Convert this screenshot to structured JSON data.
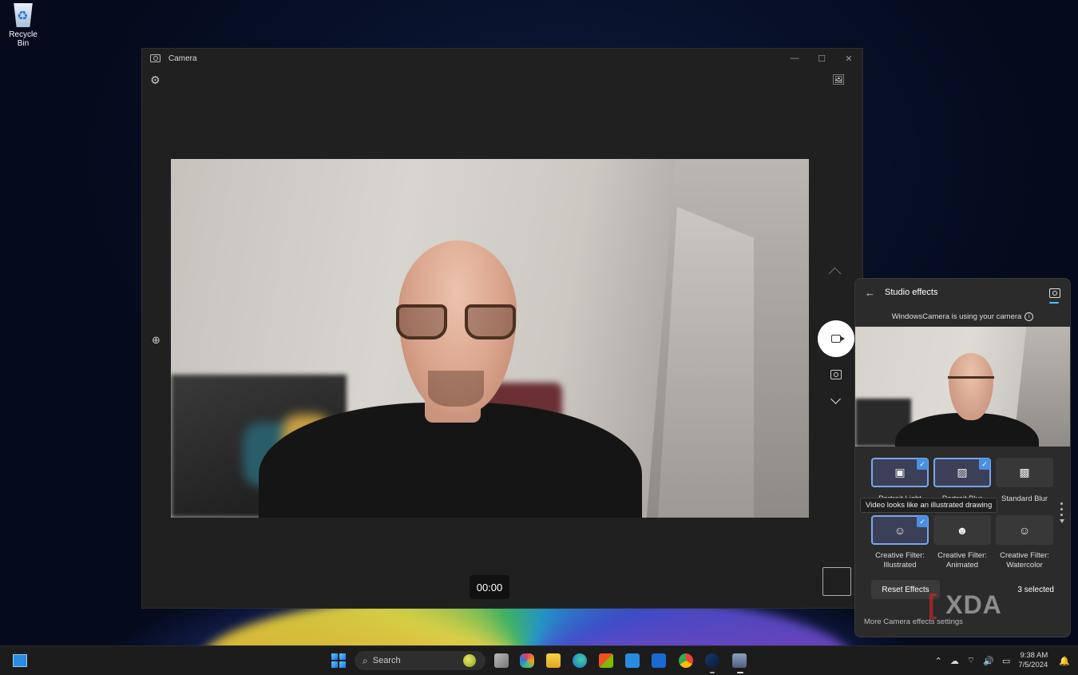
{
  "desktop": {
    "recycle_bin_label": "Recycle Bin"
  },
  "camera_window": {
    "title": "Camera",
    "icons": {
      "settings": "gear-icon",
      "gallery": "gallery-icon",
      "zoom": "zoom-in-icon"
    },
    "timer": "00:00"
  },
  "studio_effects": {
    "title": "Studio effects",
    "usage_text": "WindowsCamera is using your camera",
    "tooltip": "Video looks like an illustrated drawing",
    "effects": [
      {
        "label": "Portrait Light",
        "selected": true
      },
      {
        "label": "Portrait Blur",
        "selected": true
      },
      {
        "label": "Standard Blur",
        "selected": false
      },
      {
        "label": "Creative Filter: Illustrated",
        "selected": true
      },
      {
        "label": "Creative Filter: Animated",
        "selected": false
      },
      {
        "label": "Creative Filter: Watercolor",
        "selected": false
      }
    ],
    "reset_label": "Reset Effects",
    "selected_count": "3 selected",
    "more_settings": "More Camera effects settings",
    "accent": "#4cc2ff"
  },
  "watermark": "XDA",
  "taskbar": {
    "search_placeholder": "Search",
    "time": "9:38 AM",
    "date": "7/5/2024"
  }
}
